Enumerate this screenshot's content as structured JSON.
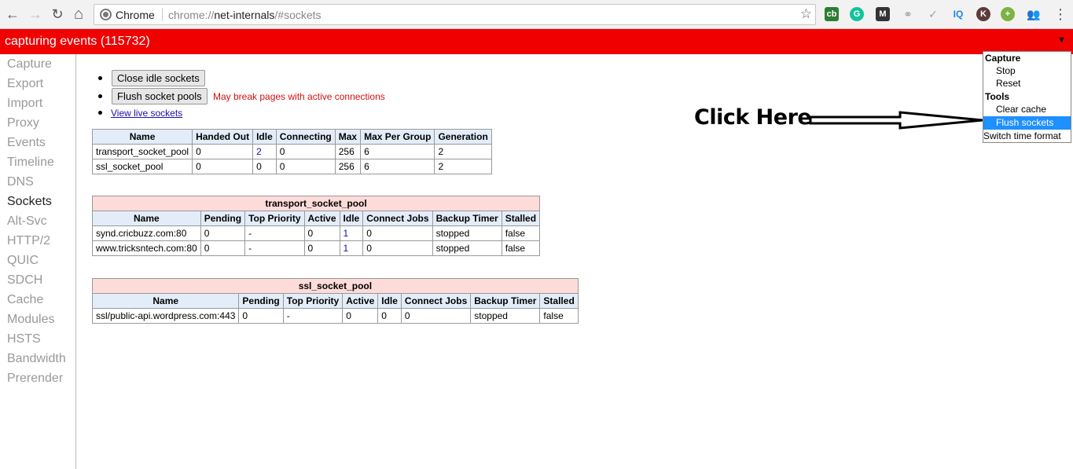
{
  "browser": {
    "chip_label": "Chrome",
    "url_prefix": "chrome://",
    "url_host": "net-internals",
    "url_path": "/#sockets",
    "nav": {
      "back": "←",
      "forward": "→",
      "reload": "↻",
      "home": "⌂",
      "star": "☆",
      "menu": "⋮"
    },
    "extensions": [
      {
        "name": "cb-extension-icon",
        "label": "cb",
        "color": "#2e7d32"
      },
      {
        "name": "grammarly-icon",
        "label": "G",
        "color": "#15c39a"
      },
      {
        "name": "gmail-icon",
        "label": "M",
        "color": "#333333"
      },
      {
        "name": "link-icon",
        "label": "⚭",
        "color": "#9e9e9e"
      },
      {
        "name": "check-icon",
        "label": "✓",
        "color": "#9e9e9e"
      },
      {
        "name": "iq-icon",
        "label": "IQ",
        "color": "#1e88e5"
      },
      {
        "name": "k-icon",
        "label": "K",
        "color": "#5d3a3a"
      },
      {
        "name": "plus-circle-icon",
        "label": "+",
        "color": "#7cb342"
      },
      {
        "name": "people-icon",
        "label": "👥",
        "color": "#bdbdbd"
      }
    ]
  },
  "capture_bar": {
    "title": "capturing events (115732)",
    "arrow": "▼"
  },
  "sidebar": {
    "items": [
      {
        "label": "Capture",
        "active": false
      },
      {
        "label": "Export",
        "active": false
      },
      {
        "label": "Import",
        "active": false
      },
      {
        "label": "Proxy",
        "active": false
      },
      {
        "label": "Events",
        "active": false
      },
      {
        "label": "Timeline",
        "active": false
      },
      {
        "label": "DNS",
        "active": false
      },
      {
        "label": "Sockets",
        "active": true
      },
      {
        "label": "Alt-Svc",
        "active": false
      },
      {
        "label": "HTTP/2",
        "active": false
      },
      {
        "label": "QUIC",
        "active": false
      },
      {
        "label": "SDCH",
        "active": false
      },
      {
        "label": "Cache",
        "active": false
      },
      {
        "label": "Modules",
        "active": false
      },
      {
        "label": "HSTS",
        "active": false
      },
      {
        "label": "Bandwidth",
        "active": false
      },
      {
        "label": "Prerender",
        "active": false
      }
    ]
  },
  "actions": {
    "close_idle": "Close idle sockets",
    "flush_pools": "Flush socket pools",
    "warning": "May break pages with active connections",
    "view_live": "View live sockets"
  },
  "pools_table": {
    "headers": [
      "Name",
      "Handed Out",
      "Idle",
      "Connecting",
      "Max",
      "Max Per Group",
      "Generation"
    ],
    "rows": [
      [
        "transport_socket_pool",
        "0",
        "2",
        "0",
        "256",
        "6",
        "2"
      ],
      [
        "ssl_socket_pool",
        "0",
        "0",
        "0",
        "256",
        "6",
        "2"
      ]
    ]
  },
  "transport_pool": {
    "title": "transport_socket_pool",
    "headers": [
      "Name",
      "Pending",
      "Top Priority",
      "Active",
      "Idle",
      "Connect Jobs",
      "Backup Timer",
      "Stalled"
    ],
    "rows": [
      [
        "synd.cricbuzz.com:80",
        "0",
        "-",
        "0",
        "1",
        "0",
        "stopped",
        "false"
      ],
      [
        "www.tricksntech.com:80",
        "0",
        "-",
        "0",
        "1",
        "0",
        "stopped",
        "false"
      ]
    ]
  },
  "ssl_pool": {
    "title": "ssl_socket_pool",
    "headers": [
      "Name",
      "Pending",
      "Top Priority",
      "Active",
      "Idle",
      "Connect Jobs",
      "Backup Timer",
      "Stalled"
    ],
    "rows": [
      [
        "ssl/public-api.wordpress.com:443",
        "0",
        "-",
        "0",
        "0",
        "0",
        "stopped",
        "false"
      ]
    ]
  },
  "menu": {
    "capture_header": "Capture",
    "stop": "Stop",
    "reset": "Reset",
    "tools_header": "Tools",
    "clear_cache": "Clear cache",
    "flush_sockets": "Flush sockets",
    "switch_time": "Switch time format"
  },
  "annotation": {
    "text": "Click Here"
  }
}
